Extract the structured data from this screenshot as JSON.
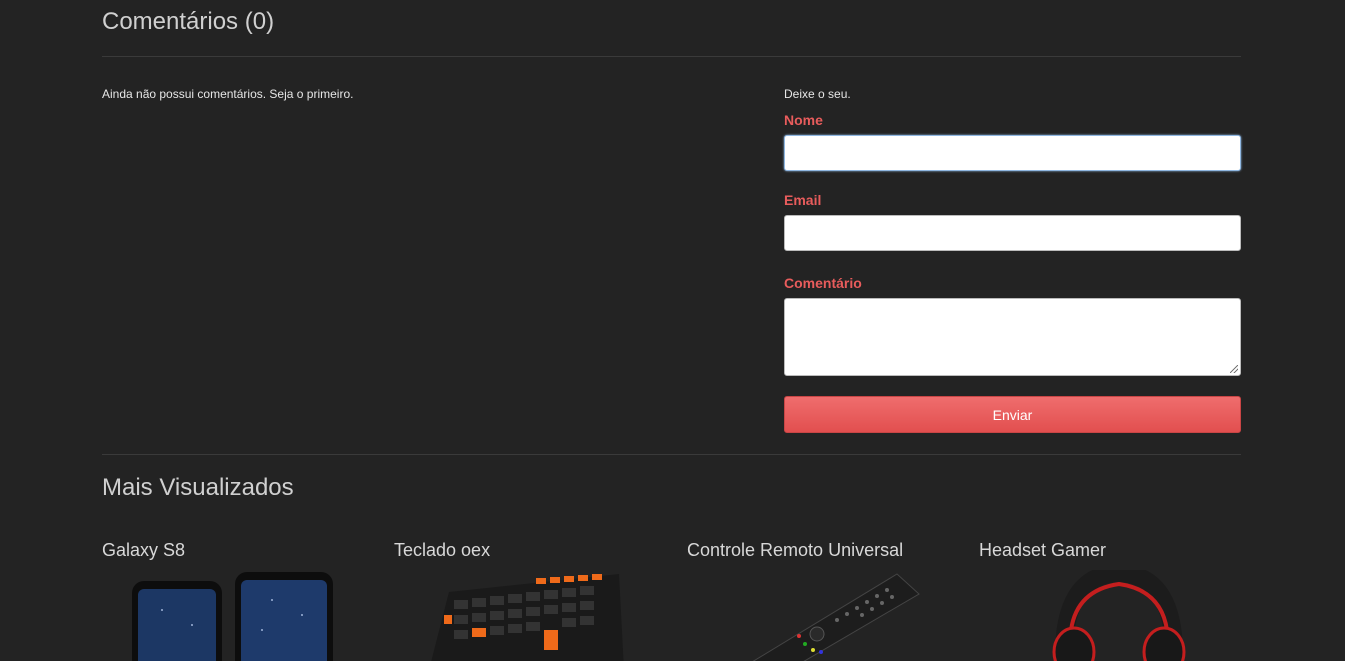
{
  "comments": {
    "title": "Comentários (0)",
    "empty_text": "Ainda não possui comentários. Seja o primeiro."
  },
  "form": {
    "intro": "Deixe o seu.",
    "name_label": "Nome",
    "email_label": "Email",
    "comment_label": "Comentário",
    "name_value": "",
    "email_value": "",
    "comment_value": "",
    "submit_label": "Enviar"
  },
  "most_viewed": {
    "title": "Mais Visualizados",
    "products": [
      {
        "name": "Galaxy S8",
        "icon": "smartphone-image"
      },
      {
        "name": "Teclado oex",
        "icon": "keyboard-image"
      },
      {
        "name": "Controle Remoto Universal",
        "icon": "remote-control-image"
      },
      {
        "name": "Headset Gamer",
        "icon": "headset-image"
      }
    ]
  },
  "colors": {
    "background": "#232323",
    "label_red": "#e85c5c",
    "button_red": "#e85858"
  }
}
